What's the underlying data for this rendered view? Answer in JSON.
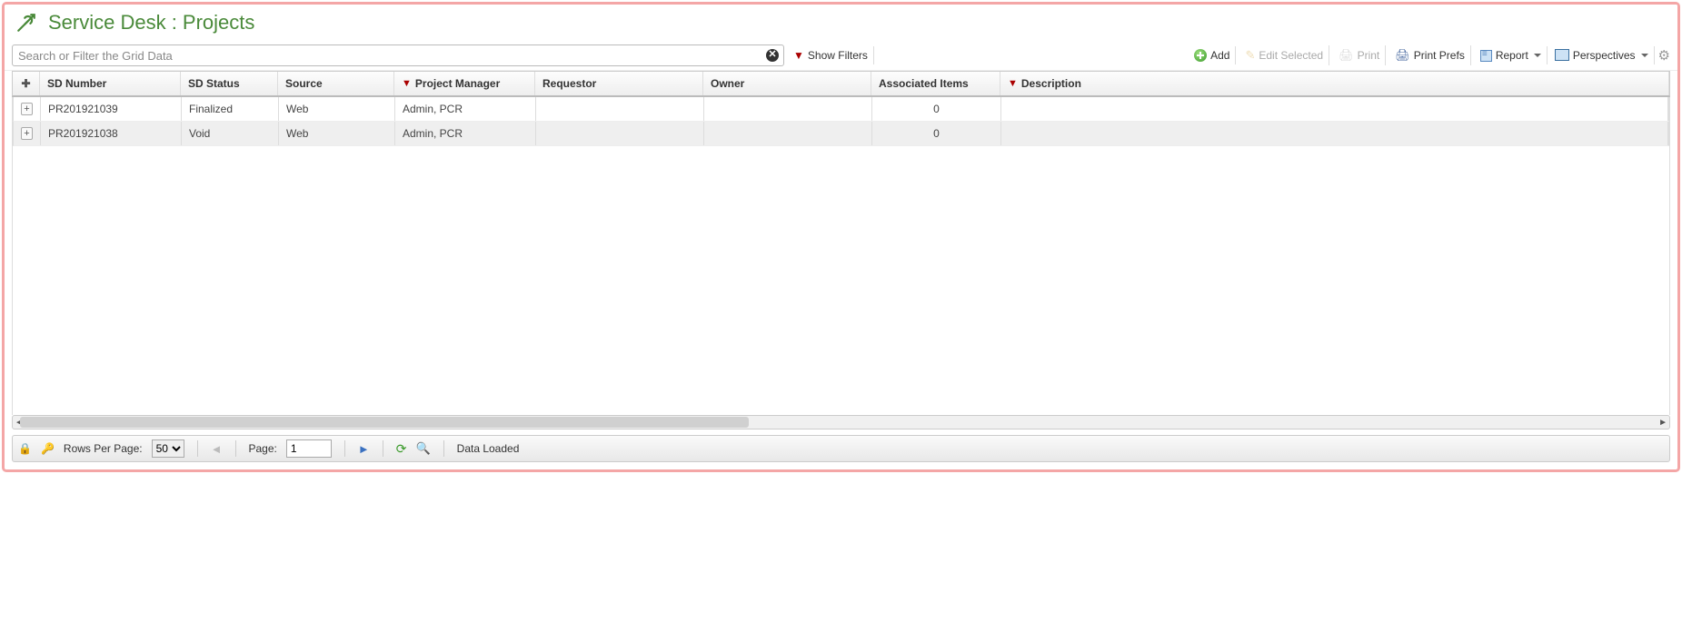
{
  "page": {
    "title": "Service Desk : Projects"
  },
  "toolbar": {
    "search_placeholder": "Search or Filter the Grid Data",
    "show_filters": "Show Filters",
    "add": "Add",
    "edit_selected": "Edit Selected",
    "print": "Print",
    "print_prefs": "Print Prefs",
    "report": "Report",
    "perspectives": "Perspectives"
  },
  "columns": {
    "sd_number": "SD Number",
    "sd_status": "SD Status",
    "source": "Source",
    "project_manager": "Project Manager",
    "requestor": "Requestor",
    "owner": "Owner",
    "associated_items": "Associated Items",
    "description": "Description"
  },
  "rows": [
    {
      "sd_number": "PR201921039",
      "sd_status": "Finalized",
      "source": "Web",
      "project_manager": "Admin, PCR",
      "requestor": "",
      "owner": "",
      "associated_items": "0",
      "description": ""
    },
    {
      "sd_number": "PR201921038",
      "sd_status": "Void",
      "source": "Web",
      "project_manager": "Admin, PCR",
      "requestor": "",
      "owner": "",
      "associated_items": "0",
      "description": ""
    }
  ],
  "footer": {
    "rows_per_page_label": "Rows Per Page:",
    "rows_per_page_value": "50",
    "page_label": "Page:",
    "page_value": "1",
    "status": "Data Loaded"
  }
}
